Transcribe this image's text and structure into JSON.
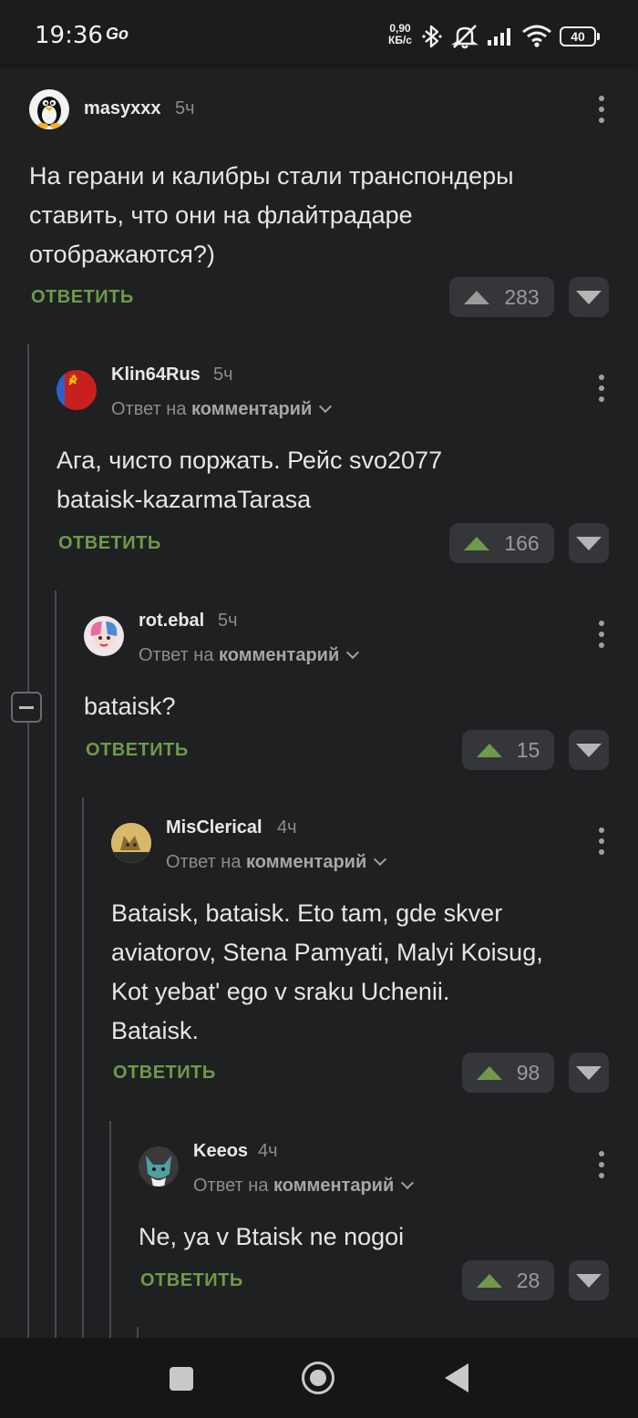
{
  "status_bar": {
    "time": "19:36",
    "app_badge": "Go",
    "net_speed_value": "0,90",
    "net_speed_unit": "КБ/с",
    "battery": "40"
  },
  "reply_to": {
    "prefix": "Ответ на",
    "target": "комментарий"
  },
  "reply_label": "ОТВЕТИТЬ",
  "comments": [
    {
      "username": "masyxxx",
      "time": "5ч",
      "text": "На герани и калибры стали транспондеры\nставить, что они на флайтрадаре\nотображаются?)",
      "votes": "283",
      "avatar_icon": "penguin-avatar"
    },
    {
      "username": "Klin64Rus",
      "time": "5ч",
      "text": "Ага, чисто поржать. Рейс svo2077\nbataisk-kazarmaTarasa",
      "votes": "166",
      "avatar_icon": "ussr-flag-avatar"
    },
    {
      "username": "rot.ebal",
      "time": "5ч",
      "text": "bataisk?",
      "votes": "15",
      "avatar_icon": "harley-avatar"
    },
    {
      "username": "MisClerical",
      "time": "4ч",
      "text": "Bataisk, bataisk. Eto tam, gde skver\naviatorov, Stena Pamyati, Malyi Koisug,\nKot yebat' ego v sraku Uchenii.\nBataisk.",
      "votes": "98",
      "avatar_icon": "cat-avatar"
    },
    {
      "username": "Keeos",
      "time": "4ч",
      "text": "Ne, ya v Btaisk ne nogoi",
      "votes": "28",
      "avatar_icon": "fox-avatar"
    }
  ],
  "colors": {
    "background": "#1f2022",
    "accent_green": "#6e9a4a",
    "thread_line": "#4a4b4e",
    "button_bg": "#34363a"
  }
}
